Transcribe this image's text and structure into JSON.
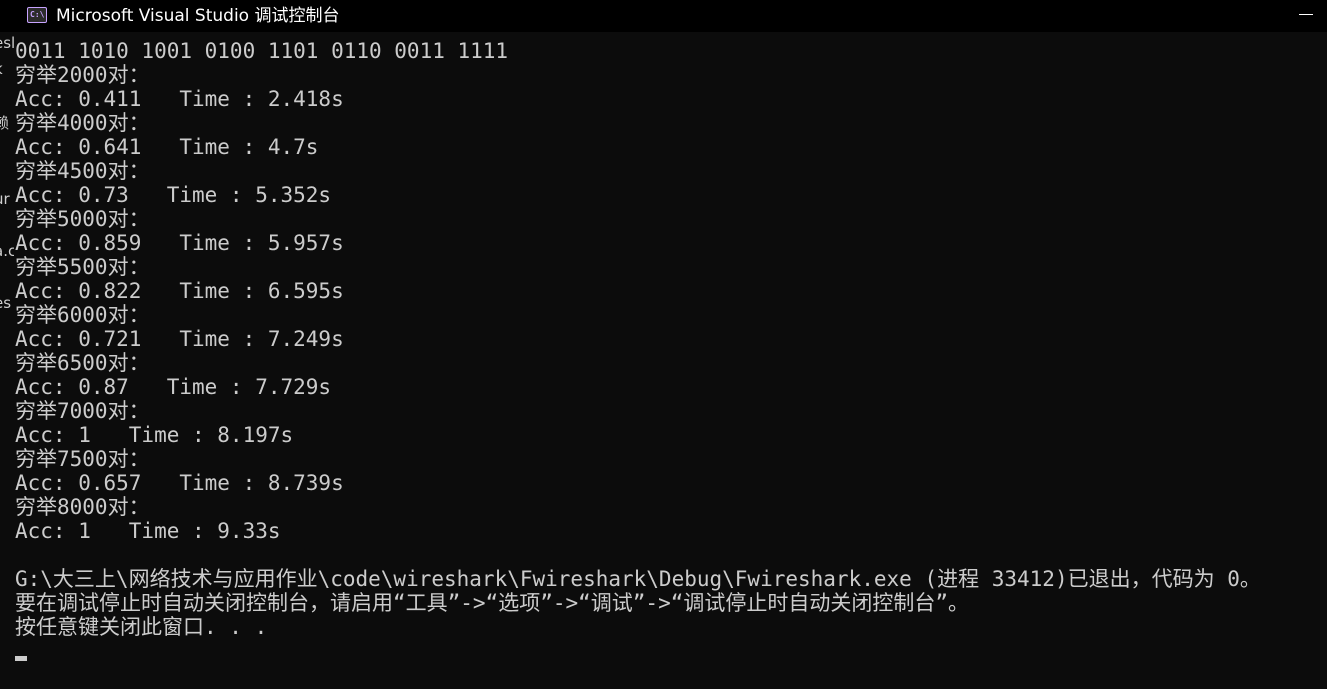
{
  "window": {
    "title": "Microsoft Visual Studio 调试控制台",
    "icon": "console-app-icon",
    "icon_text": "C:\\",
    "accent_icon_color": "#c7a3ff"
  },
  "background_fragments": [
    "理",
    "esl",
    "k",
    "赖",
    "ur",
    "a.c",
    "t",
    "es"
  ],
  "console_lines": [
    "0011 1010 1001 0100 1101 0110 0011 1111",
    "穷举2000对：",
    "Acc: 0.411   Time : 2.418s",
    "穷举4000对：",
    "Acc: 0.641   Time : 4.7s",
    "穷举4500对：",
    "Acc: 0.73   Time : 5.352s",
    "穷举5000对：",
    "Acc: 0.859   Time : 5.957s",
    "穷举5500对：",
    "Acc: 0.822   Time : 6.595s",
    "穷举6000对：",
    "Acc: 0.721   Time : 7.249s",
    "穷举6500对：",
    "Acc: 0.87   Time : 7.729s",
    "穷举7000对：",
    "Acc: 1   Time : 8.197s",
    "穷举7500对：",
    "Acc: 0.657   Time : 8.739s",
    "穷举8000对：",
    "Acc: 1   Time : 9.33s",
    "",
    "G:\\大三上\\网络技术与应用作业\\code\\wireshark\\Fwireshark\\Debug\\Fwireshark.exe (进程 33412)已退出，代码为 0。",
    "要在调试停止时自动关闭控制台，请启用“工具”->“选项”->“调试”->“调试停止时自动关闭控制台”。",
    "按任意键关闭此窗口. . ."
  ]
}
